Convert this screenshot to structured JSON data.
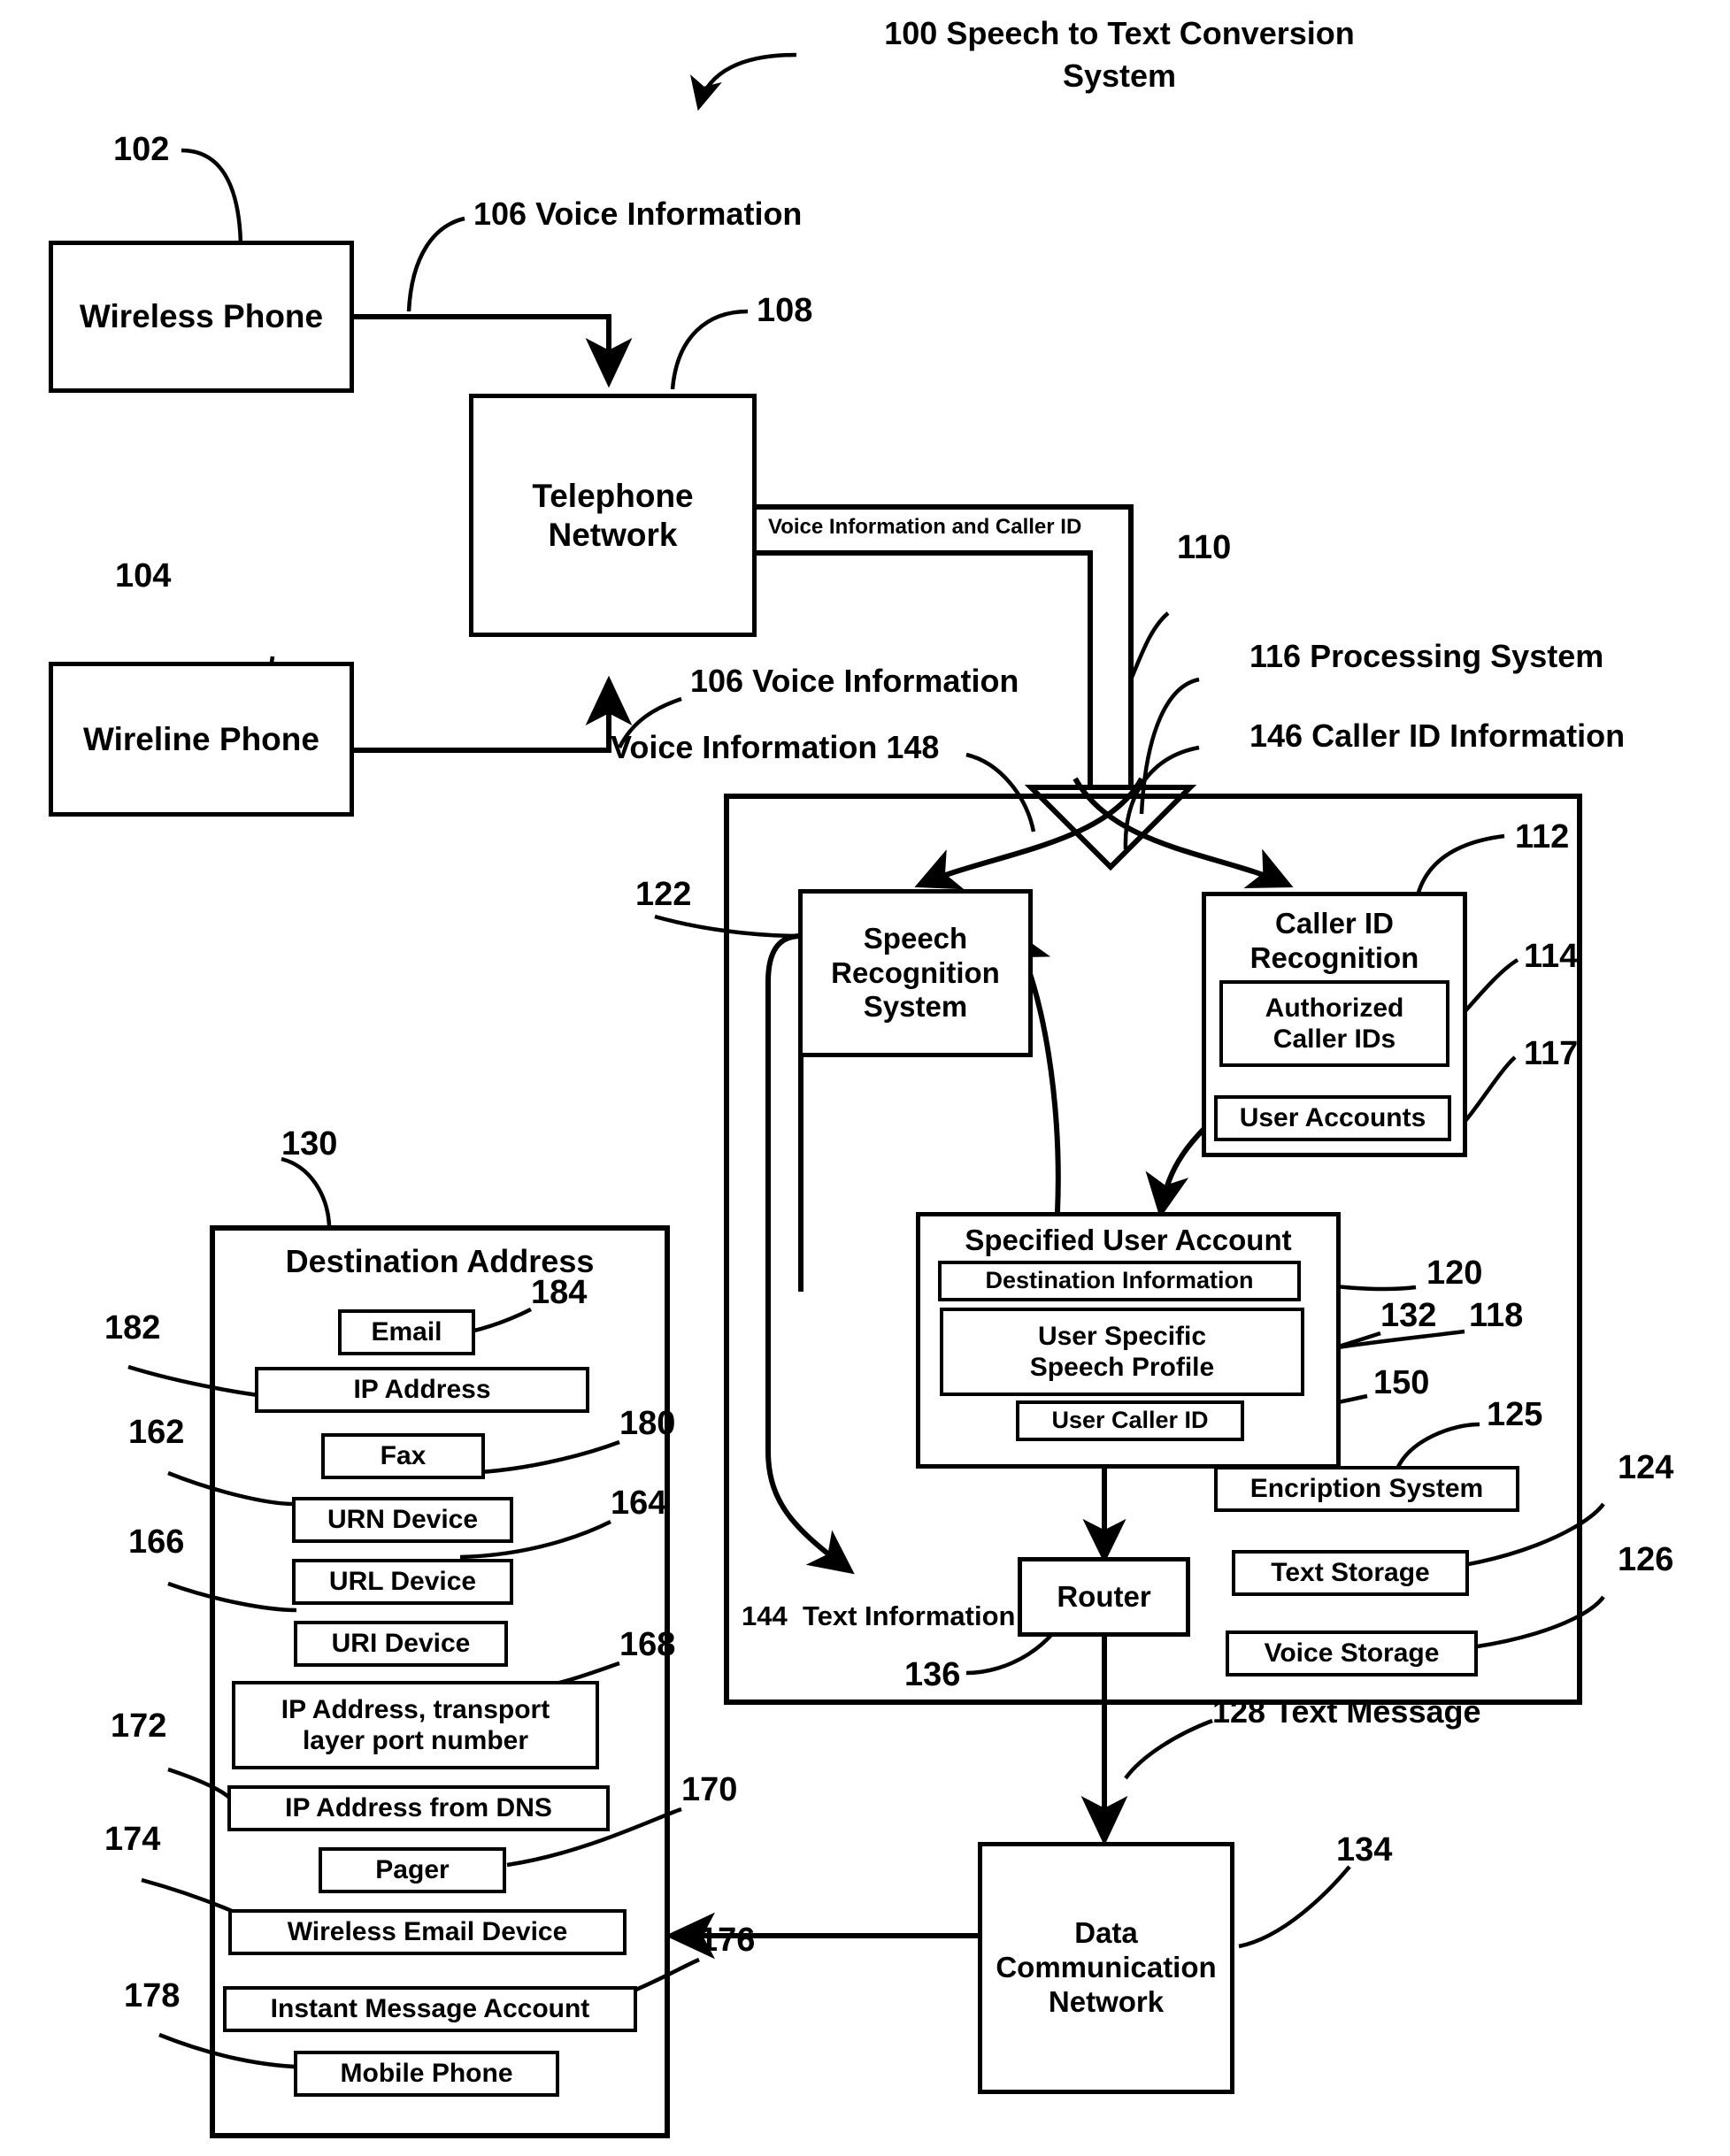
{
  "figure": {
    "title": "100 Speech to Text Conversion System",
    "title_line1": "100 Speech to Text Conversion",
    "title_line2": "System"
  },
  "nodes": {
    "wireless_phone": "Wireless Phone",
    "wireline_phone": "Wireline Phone",
    "telephone_network_l1": "Telephone",
    "telephone_network_l2": "Network",
    "speech_recognition_l1": "Speech",
    "speech_recognition_l2": "Recognition",
    "speech_recognition_l3": "System",
    "caller_id_recognition_l1": "Caller ID",
    "caller_id_recognition_l2": "Recognition",
    "authorized_caller_ids_l1": "Authorized",
    "authorized_caller_ids_l2": "Caller IDs",
    "user_accounts": "User Accounts",
    "specified_user_account": "Specified User Account",
    "destination_information": "Destination Information",
    "user_specific_speech_profile_l1": "User Specific",
    "user_specific_speech_profile_l2": "Speech Profile",
    "user_caller_id": "User Caller ID",
    "encription_system": "Encription System",
    "text_storage": "Text Storage",
    "voice_storage": "Voice Storage",
    "router": "Router",
    "data_communication_network_l1": "Data",
    "data_communication_network_l2": "Communication",
    "data_communication_network_l3": "Network",
    "destination_address": "Destination Address"
  },
  "destination_items": [
    {
      "label": "Email",
      "ref": "184"
    },
    {
      "label": "IP Address",
      "ref": "182"
    },
    {
      "label": "Fax",
      "ref": "180"
    },
    {
      "label": "URN Device",
      "ref": "162"
    },
    {
      "label": "URL Device",
      "ref": "164"
    },
    {
      "label": "URI Device",
      "ref": "166"
    },
    {
      "label": "IP Address, transport layer port number",
      "ref": "168"
    },
    {
      "label": "IP Address from DNS",
      "ref": "172"
    },
    {
      "label": "Pager",
      "ref": "170"
    },
    {
      "label": "Wireless Email Device",
      "ref": "174"
    },
    {
      "label": "Instant Message Account",
      "ref": "176"
    },
    {
      "label": "Mobile Phone",
      "ref": "178"
    }
  ],
  "destination_item_lines": {
    "ip_transport_l1": "IP Address, transport",
    "ip_transport_l2": "layer port number"
  },
  "flow_labels": {
    "voice_information_106_a": "106 Voice Information",
    "voice_information_106_b": "106 Voice Information",
    "voice_information_and_caller_id": "Voice Information and Caller ID",
    "voice_information_148": "Voice Information 148",
    "caller_id_information_146": "146 Caller ID Information",
    "processing_system_116": "116 Processing System",
    "text_information_144": "144  Text Information",
    "text_message_128": "128 Text Message"
  },
  "refs": {
    "r100": "100",
    "r102": "102",
    "r104": "104",
    "r108": "108",
    "r110": "110",
    "r112": "112",
    "r114": "114",
    "r117": "117",
    "r118": "118",
    "r120": "120",
    "r122": "122",
    "r124": "124",
    "r125": "125",
    "r126": "126",
    "r130": "130",
    "r132": "132",
    "r134": "134",
    "r136": "136",
    "r150": "150",
    "r162": "162",
    "r164": "164",
    "r166": "166",
    "r168": "168",
    "r170": "170",
    "r172": "172",
    "r174": "174",
    "r176": "176",
    "r178": "178",
    "r180": "180",
    "r182": "182",
    "r184": "184"
  },
  "colors": {
    "ink": "#000000",
    "paper": "#ffffff"
  }
}
